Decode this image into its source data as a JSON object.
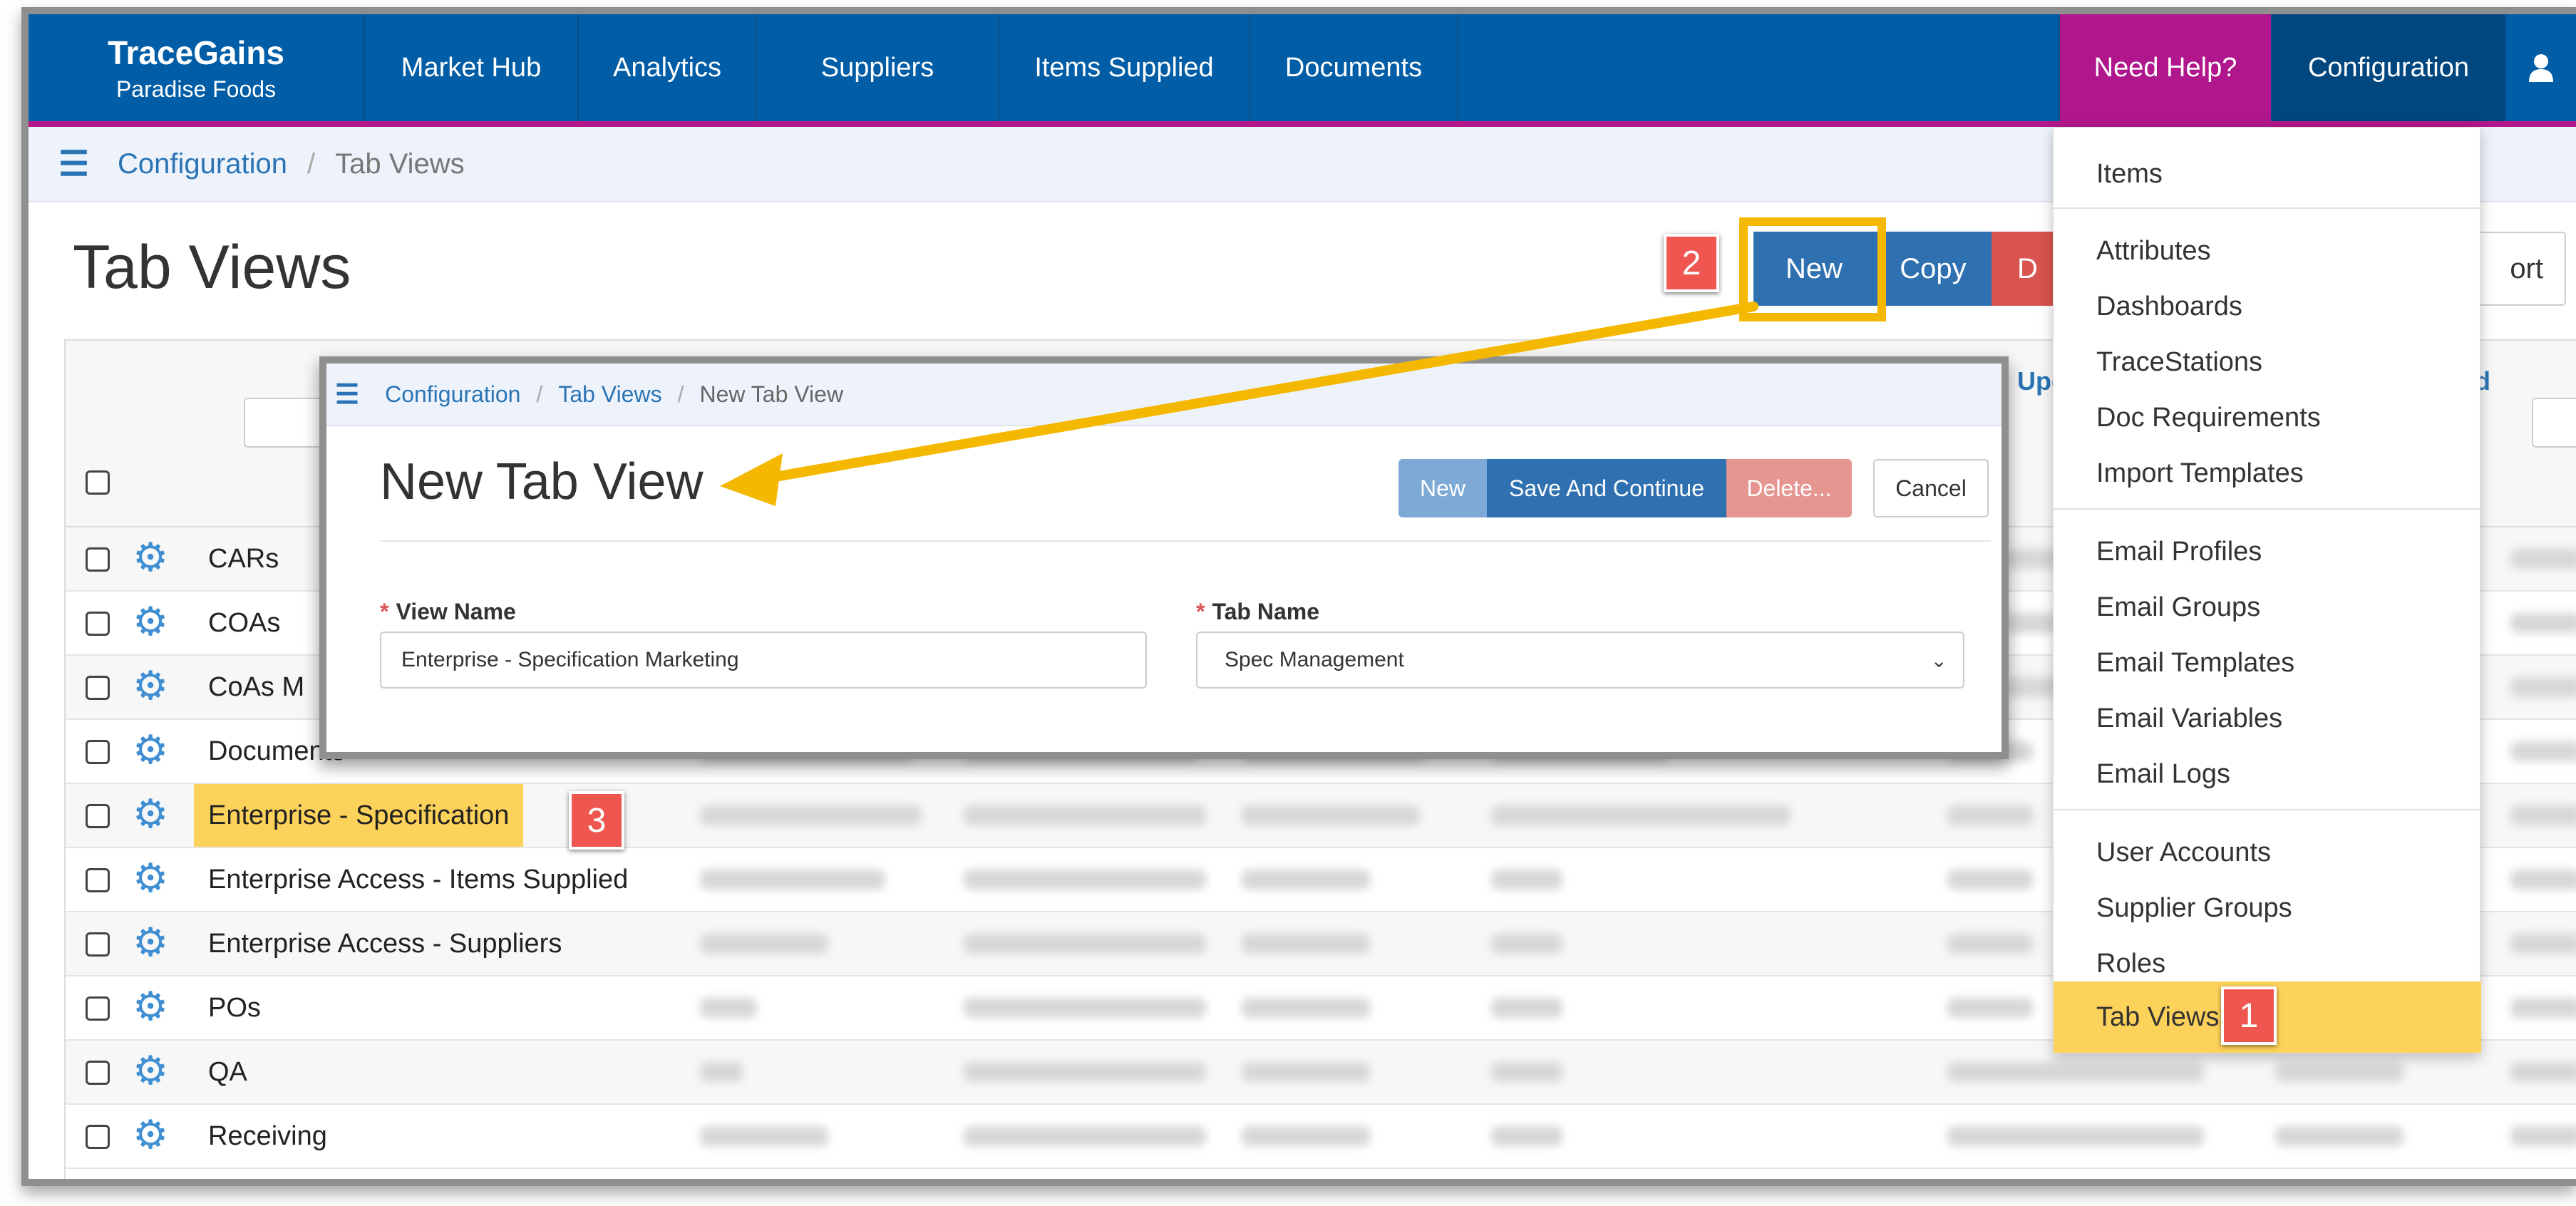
{
  "brand": {
    "name": "TraceGains",
    "company": "Paradise Foods"
  },
  "nav": {
    "items": [
      "Market Hub",
      "Analytics",
      "Suppliers",
      "Items Supplied",
      "Documents"
    ],
    "help": "Need Help?",
    "config": "Configuration",
    "user_icon": "user-icon"
  },
  "breadcrumb": {
    "root": "Configuration",
    "sep": "/",
    "current": "Tab Views"
  },
  "page": {
    "title": "Tab Views"
  },
  "actions": {
    "new": "New",
    "copy": "Copy",
    "delete": "D",
    "export": "ort"
  },
  "table": {
    "header_partial_1": "Upd",
    "header_partial_2": "d",
    "rows": [
      "CARs",
      "COAs",
      "CoAs M",
      "Documents",
      "Enterprise - Specification",
      "Enterprise Access - Items Supplied",
      "Enterprise Access - Suppliers",
      "POs",
      "QA",
      "Receiving"
    ]
  },
  "dropdown": {
    "groups": [
      [
        "Items"
      ],
      [
        "Attributes",
        "Dashboards",
        "TraceStations",
        "Doc Requirements",
        "Import Templates"
      ],
      [
        "Email Profiles",
        "Email Groups",
        "Email Templates",
        "Email Variables",
        "Email Logs"
      ],
      [
        "User Accounts",
        "Supplier Groups",
        "Roles",
        "Tab Views"
      ]
    ],
    "selected": "Tab Views"
  },
  "callouts": {
    "step1": "1",
    "step2": "2",
    "step3": "3"
  },
  "modal": {
    "breadcrumb": {
      "root": "Configuration",
      "mid": "Tab Views",
      "current": "New Tab View",
      "sep": "/"
    },
    "title": "New Tab View",
    "buttons": {
      "new": "New",
      "save": "Save And Continue",
      "delete": "Delete...",
      "cancel": "Cancel"
    },
    "fields": {
      "view_name_label": "View Name",
      "view_name_value": "Enterprise - Specification Marketing",
      "tab_name_label": "Tab Name",
      "tab_name_value": "Spec Management",
      "required_mark": "*"
    }
  },
  "colors": {
    "nav_bg": "#005da6",
    "accent": "#b3178c",
    "highlight": "#fdd25a",
    "arrow": "#f5b800",
    "danger": "#d9534f"
  }
}
